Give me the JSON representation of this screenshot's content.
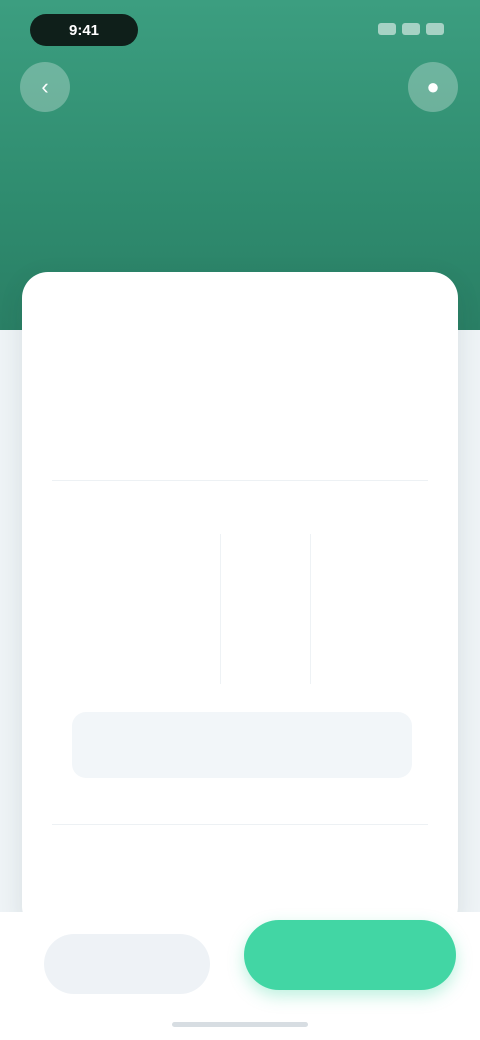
{
  "status_bar": {
    "time": "9:41"
  },
  "header": {
    "left_icon": "back-arrow-icon",
    "right_icon": "profile-icon",
    "subtitle": "",
    "amount": "",
    "amount_unit": ""
  },
  "card": {
    "title": "",
    "rows": [
      {
        "label": "",
        "value": ""
      },
      {
        "label": "",
        "value": ""
      }
    ],
    "table": {
      "columns": [
        "",
        "",
        ""
      ],
      "values": [
        "",
        "",
        ""
      ],
      "notes": [
        "",
        ""
      ]
    },
    "notice": {
      "line1": "",
      "line2": ""
    },
    "link": ""
  },
  "actions": {
    "secondary": "",
    "primary": ""
  },
  "colors": {
    "header_green": "#2f8c6f",
    "accent_green": "#42d6a4",
    "value_green": "#3fbf8f"
  }
}
